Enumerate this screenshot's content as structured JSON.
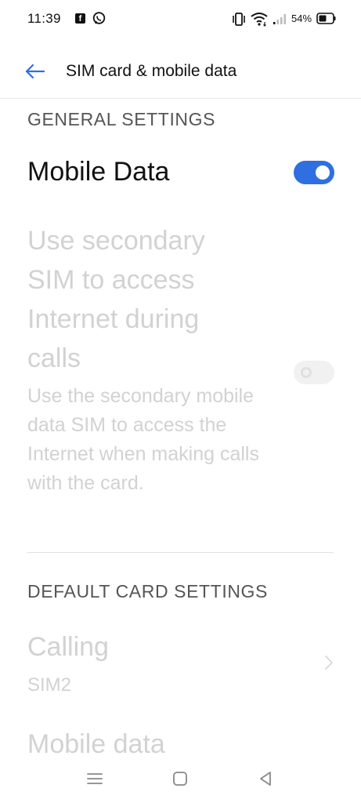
{
  "status_bar": {
    "time": "11:39",
    "battery_percent": "54%",
    "icons": [
      "facebook-icon",
      "viber-icon",
      "vibrate-icon",
      "wifi-icon",
      "signal-icon",
      "battery-icon"
    ]
  },
  "app_bar": {
    "back_icon": "back-arrow-icon",
    "title": "SIM card & mobile data"
  },
  "general_settings": {
    "header": "GENERAL SETTINGS",
    "mobile_data": {
      "label": "Mobile Data",
      "enabled": true
    },
    "secondary_sim": {
      "title": "Use secondary SIM to access Internet during calls",
      "description": "Use the secondary mobile data SIM to access the Internet when making calls with the card.",
      "enabled": false,
      "disabled_state": true
    }
  },
  "default_card_settings": {
    "header": "DEFAULT CARD SETTINGS",
    "calling": {
      "label": "Calling",
      "value": "SIM2"
    },
    "mobile_data": {
      "label": "Mobile data"
    }
  },
  "nav_bar": {
    "icons": [
      "menu-icon",
      "home-icon",
      "back-icon"
    ]
  },
  "colors": {
    "accent": "#2f6fe0",
    "disabled_text": "#d2d2d2",
    "section_header": "#555555"
  }
}
